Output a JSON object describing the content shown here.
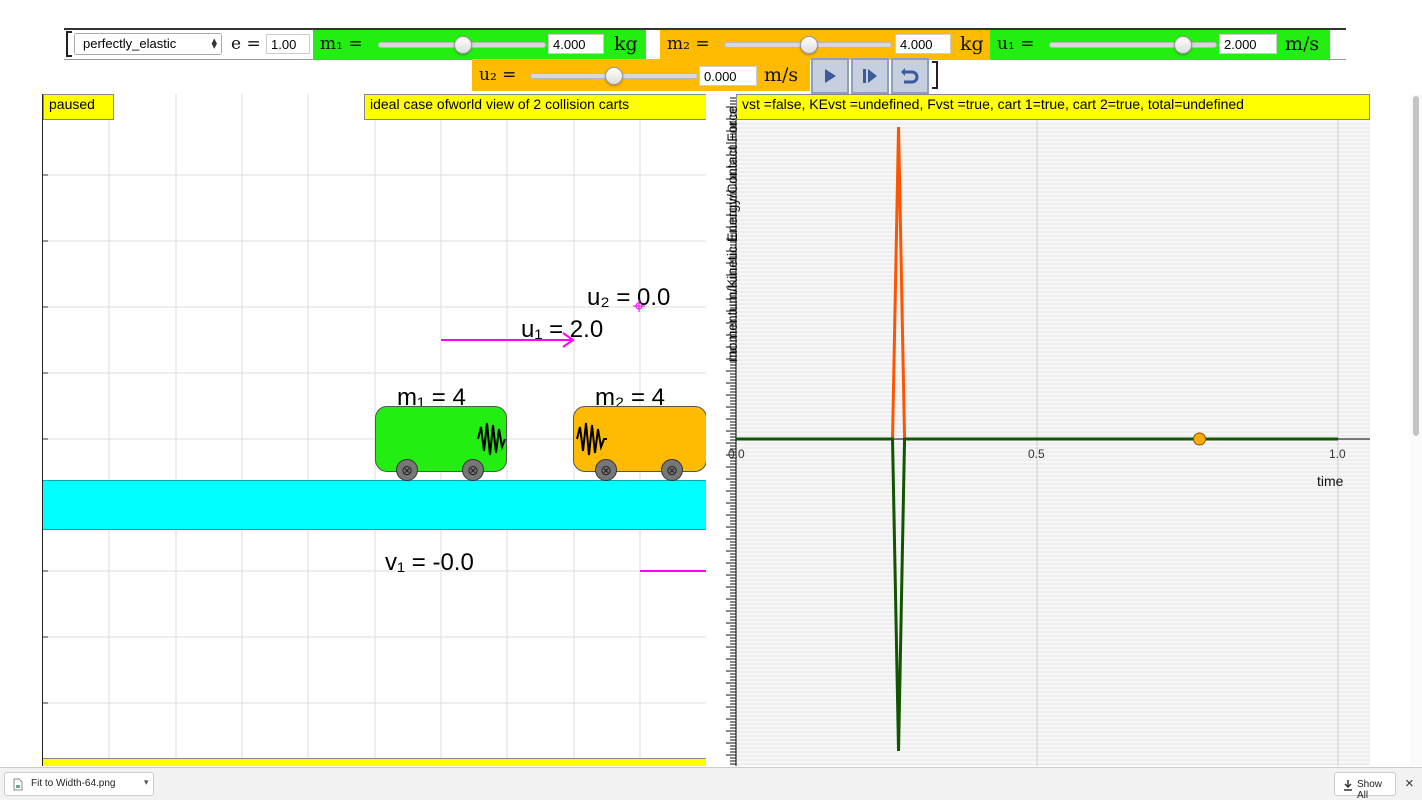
{
  "controls": {
    "collision_type": "perfectly_elastic",
    "e_label": "e =",
    "e_value": "1.00",
    "m1_label": "m₁ =",
    "m1_value": "4.000",
    "m1_unit": "kg",
    "m1_slider": 0.5,
    "m2_label": "m₂ =",
    "m2_value": "4.000",
    "m2_unit": "kg",
    "m2_slider": 0.5,
    "u1_label": "u₁ =",
    "u1_value": "2.000",
    "u1_unit": "m/s",
    "u1_slider": 0.83,
    "u2_label": "u₂ =",
    "u2_value": "0.000",
    "u2_unit": "m/s",
    "u2_slider": 0.5
  },
  "left_panel": {
    "status": "paused",
    "title": "ideal case ofworld view of 2 collision carts",
    "u2_text": "u₂ = 0.0",
    "u1_text": "u₁ = 2.0",
    "m1_text": "m₁ = 4",
    "m2_text": "m₂ = 4",
    "v1_text": "v₁ = -0.0",
    "cart1_color": "#22ee11",
    "cart2_color": "#ffbb00",
    "track_color": "#00ffff",
    "arrow_color": "#ff00ff"
  },
  "right_panel": {
    "status_line": "vst =false, KEvst =undefined, Fvst =true, cart 1=true, cart 2=true, total=undefined",
    "y_axis_label": "momentum/Kinetic Energy/Contact Force",
    "x_axis_label": "time",
    "x_ticks": [
      "0.0",
      "0.5",
      "1.0"
    ],
    "force_line_colors": [
      "#ff5500",
      "#115500"
    ]
  },
  "chart_data": {
    "type": "line",
    "xlabel": "time",
    "ylabel": "momentum/Kinetic Energy/Contact Force",
    "xlim": [
      0,
      1.0
    ],
    "series": [
      {
        "name": "cart 1",
        "x": [
          0,
          0.26,
          0.27,
          0.28,
          1.0
        ],
        "y": [
          0,
          0,
          1,
          0,
          0
        ],
        "color": "#ff5500"
      },
      {
        "name": "cart 2",
        "x": [
          0,
          0.26,
          0.27,
          0.28,
          1.0
        ],
        "y": [
          0,
          0,
          -1,
          0,
          0
        ],
        "color": "#115500"
      }
    ],
    "marker_x": 0.77
  },
  "download_bar": {
    "filename": "Fit to Width-64.png",
    "show_all": "Show All",
    "close": "×"
  }
}
